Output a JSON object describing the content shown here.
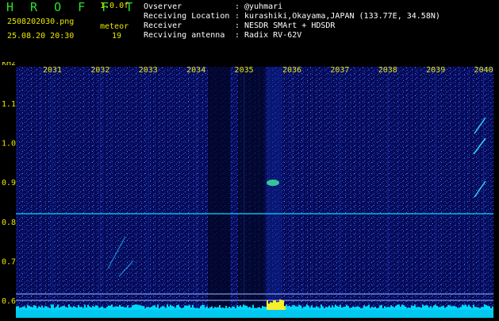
{
  "app": {
    "name": "H R O F F T",
    "version": "1.0.0f"
  },
  "file": {
    "name": "2508202030.png",
    "datetime": "25.08.20 20:30"
  },
  "detector": {
    "label": "meteor",
    "count": "19"
  },
  "meta": [
    {
      "key": "Ovserver",
      "value": ": @yuhmari"
    },
    {
      "key": "Receiving Location",
      "value": ": kurashiki,Okayama,JAPAN (133.77E, 34.58N)"
    },
    {
      "key": "Receiver",
      "value": ": NESDR SMArt + HDSDR"
    },
    {
      "key": "Recviving antenna",
      "value": ": Radix RV-62V"
    }
  ],
  "axis": {
    "y_unit": "kHz",
    "y_ticks": [
      "1.1",
      "1.0",
      "0.9",
      "0.8",
      "0.7",
      "0.6"
    ],
    "x_ticks": [
      "2031",
      "2032",
      "2033",
      "2034",
      "2035",
      "2036",
      "2037",
      "2038",
      "2039",
      "2040"
    ]
  },
  "colors": {
    "label": "#e8e800",
    "brand": "#2be22b",
    "text": "#ffffff",
    "signal": "#00d8ff"
  }
}
